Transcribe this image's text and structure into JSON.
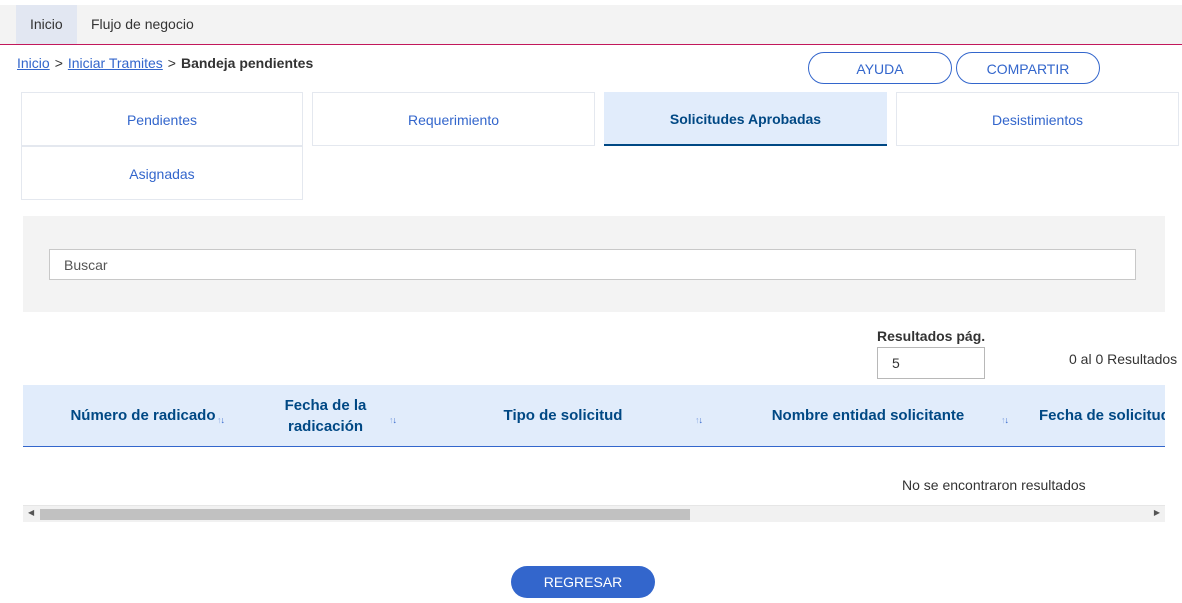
{
  "topnav": {
    "items": [
      "Inicio",
      "Flujo de negocio"
    ]
  },
  "breadcrumb": {
    "home": "Inicio",
    "separator": ">",
    "level2": "Iniciar Tramites",
    "current": "Bandeja pendientes"
  },
  "actions": {
    "help": "AYUDA",
    "share": "COMPARTIR"
  },
  "tabs": {
    "items": [
      "Pendientes",
      "Requerimiento",
      "Solicitudes Aprobadas",
      "Desistimientos",
      "Asignadas"
    ],
    "active": "Solicitudes Aprobadas"
  },
  "search": {
    "placeholder": "Buscar"
  },
  "pagination": {
    "label": "Resultados pág.",
    "page_size": "5",
    "results_text": "0 al 0 Resultados"
  },
  "table": {
    "columns": [
      {
        "line1": "Número de radicado",
        "line2": ""
      },
      {
        "line1": "Fecha de la",
        "line2": "radicación"
      },
      {
        "line1": "Tipo de solicitud",
        "line2": ""
      },
      {
        "line1": "Nombre entidad solicitante",
        "line2": ""
      },
      {
        "line1": "Fecha de solicitud",
        "line2": ""
      }
    ],
    "sort_icon": "↑↓",
    "empty_message": "No se encontraron resultados"
  },
  "footer": {
    "back_button": "REGRESAR"
  },
  "colors": {
    "accent": "#3366cc",
    "active_tab_bg": "#e1ecfb",
    "nav_border": "#c2185b",
    "dark_blue": "#004884"
  }
}
